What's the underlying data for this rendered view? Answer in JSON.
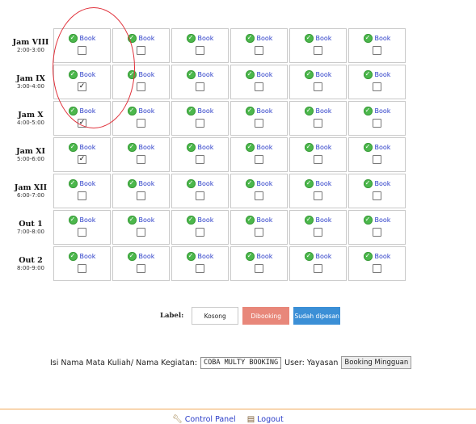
{
  "schedule": {
    "book_label": "Book",
    "rows": [
      {
        "name": "Jam VIII",
        "time": "2:00-3:00",
        "checked": [
          false,
          false,
          false,
          false,
          false,
          false
        ]
      },
      {
        "name": "Jam IX",
        "time": "3:00-4:00",
        "checked": [
          true,
          false,
          false,
          false,
          false,
          false
        ]
      },
      {
        "name": "Jam X",
        "time": "4:00-5:00",
        "checked": [
          true,
          false,
          false,
          false,
          false,
          false
        ]
      },
      {
        "name": "Jam XI",
        "time": "5:00-6:00",
        "checked": [
          true,
          false,
          false,
          false,
          false,
          false
        ]
      },
      {
        "name": "Jam XII",
        "time": "6:00-7:00",
        "checked": [
          false,
          false,
          false,
          false,
          false,
          false
        ]
      },
      {
        "name": "Out 1",
        "time": "7:00-8:00",
        "checked": [
          false,
          false,
          false,
          false,
          false,
          false
        ]
      },
      {
        "name": "Out 2",
        "time": "8:00-9:00",
        "checked": [
          false,
          false,
          false,
          false,
          false,
          false
        ]
      }
    ]
  },
  "legend": {
    "label": "Label:",
    "kosong": "Kosong",
    "dibooking": "Dibooking",
    "sudah": "Sudah dipesan",
    "colors": {
      "kosong": "#ffffff",
      "dibooking": "#e8877a",
      "sudah": "#3b8fd6"
    }
  },
  "form": {
    "kegiatan_label": "Isi Nama Mata Kuliah/ Nama Kegiatan:",
    "kegiatan_value": "COBA MULTY BOOKING",
    "user_text": "User: Yayasan",
    "mingguan_button": "Booking Mingguan"
  },
  "footer": {
    "control_panel": "Control Panel",
    "logout": "Logout"
  },
  "icons": {
    "book": "check-circle-icon",
    "control_panel": "wrench-icon",
    "logout": "logout-icon"
  }
}
